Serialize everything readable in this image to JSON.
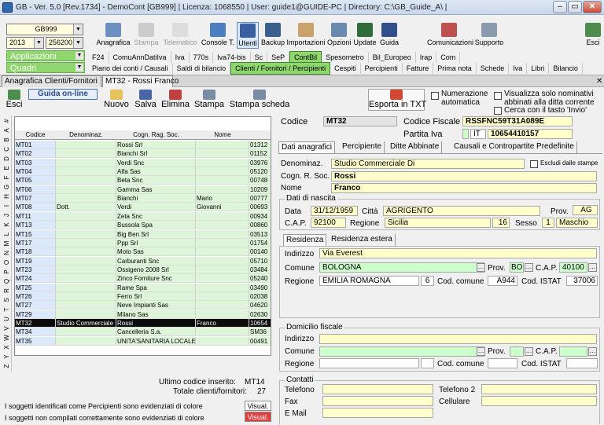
{
  "titlebar": {
    "text": "GB - Ver. 5.0 [Rev.1734] - DemoCont [GB999]   | Licenza: 1068550 | User: guide1@GUIDE-PC | Directory: C:\\GB_Guide_A\\ |"
  },
  "company": {
    "code": "GB999",
    "year": "2013",
    "period": "256200 -"
  },
  "toolbar": {
    "anagrafica": "Anagrafica",
    "stampa": "Stampa",
    "telematico": "Telematico",
    "console": "Console T.",
    "utenti": "Utenti",
    "backup": "Backup",
    "importazioni": "Importazioni",
    "opzioni": "Opzioni",
    "update": "Update",
    "guida": "Guida",
    "comunicazioni": "Comunicazioni",
    "supporto": "Supporto",
    "esci": "Esci"
  },
  "sections": {
    "applicazioni": "Applicazioni",
    "quadri": "Quadri"
  },
  "menu1": [
    "F24",
    "ComuAnnDatiIva",
    "Iva",
    "770s",
    "Iva74-bis",
    "Sc",
    "SeP",
    "ContBil",
    "Spesometro",
    "Bil_Europeo",
    "Irap",
    "Com"
  ],
  "menu2": [
    "Piano dei conti / Causali",
    "Saldi di bilancio",
    "Clienti / Fornitori / Percipienti",
    "Cespiti",
    "Percipienti",
    "Fatture",
    "Prima nota",
    "Schede",
    "Iva",
    "Libri",
    "Bilancio"
  ],
  "tabs": {
    "t1": "Anagrafica Clienti/Fornitori",
    "t2": "MT32 - Rossi Franco"
  },
  "actions": {
    "esci": "Esci",
    "guida": "Guida on-line",
    "nuovo": "Nuovo",
    "salva": "Salva",
    "elimina": "Elimina",
    "stampa": "Stampa",
    "stampa_scheda": "Stampa scheda",
    "esporta": "Esporta in TXT"
  },
  "options": {
    "numerazione": "Numerazione automatica",
    "visualizza": "Visualizza solo nominativi abbinati alla ditta corrente",
    "cerca": "Cerca con il tasto 'Invio'"
  },
  "alphabet": [
    "#",
    "A",
    "B",
    "C",
    "D",
    "E",
    "F",
    "G",
    "H",
    "I",
    "J",
    "K",
    "L",
    "M",
    "N",
    "O",
    "P",
    "Q",
    "R",
    "S",
    "T",
    "U",
    "V",
    "W",
    "X",
    "Y",
    "Z"
  ],
  "grid": {
    "headers": [
      "Codice",
      "Denominaz.",
      "Cogn. Rag. Soc.",
      "Nome",
      ""
    ],
    "rows": [
      [
        "MT01",
        "",
        "Rossi Srl",
        "",
        "01312"
      ],
      [
        "MT02",
        "",
        "Bianchi Srl",
        "",
        "01152"
      ],
      [
        "MT03",
        "",
        "Verdi Snc",
        "",
        "03976"
      ],
      [
        "MT04",
        "",
        "Alfa Sas",
        "",
        "05120"
      ],
      [
        "MT05",
        "",
        "Beta Snc",
        "",
        "00748"
      ],
      [
        "MT06",
        "",
        "Gamma Sas",
        "",
        "10209"
      ],
      [
        "MT07",
        "",
        "Bianchi",
        "Mario",
        "00777"
      ],
      [
        "MT08",
        "Dott.",
        "Verdi",
        "Giovanni",
        "00693"
      ],
      [
        "MT11",
        "",
        "Zeta Snc",
        "",
        "00934"
      ],
      [
        "MT13",
        "",
        "Bussola Spa",
        "",
        "00860"
      ],
      [
        "MT15",
        "",
        "Big Ben Srl",
        "",
        "03513"
      ],
      [
        "MT17",
        "",
        "Ppp Srl",
        "",
        "01754"
      ],
      [
        "MT18",
        "",
        "Moto Sas",
        "",
        "00140"
      ],
      [
        "MT19",
        "",
        "Carburanti Snc",
        "",
        "05710"
      ],
      [
        "MT23",
        "",
        "Ossigeno 2008 Srl",
        "",
        "03484"
      ],
      [
        "MT24",
        "",
        "Zinco Forniture Snc",
        "",
        "05240"
      ],
      [
        "MT25",
        "",
        "Rame Spa",
        "",
        "03490"
      ],
      [
        "MT26",
        "",
        "Ferro Srl",
        "",
        "02038"
      ],
      [
        "MT27",
        "",
        "Neve Impianti Sas",
        "",
        "04620"
      ],
      [
        "MT29",
        "",
        "Milano Sas",
        "",
        "02630"
      ],
      [
        "MT32",
        "Studio Commerciale",
        "Rossi",
        "Franco",
        "10654"
      ],
      [
        "MT34",
        "",
        "Cancelleria S.a.",
        "",
        "SM36"
      ],
      [
        "MT35",
        "",
        "UNITA'SANITARIA LOCALE",
        "",
        "00491"
      ]
    ],
    "selected_index": 20
  },
  "summary": {
    "ultimo_label": "Ultimo codice inserito:",
    "ultimo": "MT14",
    "totale_label": "Totale clienti/fornitori:",
    "totale": "27"
  },
  "legend": {
    "l1": "I soggetti identificati come Percipienti sono evidenziati di colore",
    "l2": "I soggetti non compilati correttamente sono evidenziati di colore",
    "visual": "Visual."
  },
  "form": {
    "codice_label": "Codice",
    "codice": "MT32",
    "cf_label": "Codice Fiscale",
    "cf": "RSSFNC59T31A089E",
    "piva_label": "Partita Iva",
    "piva_country": "IT",
    "piva": "10654410157",
    "info_tabs": [
      "Dati anagrafici",
      "Percipiente",
      "Ditte Abbinate",
      "Causali e Contropartite Predefinite"
    ],
    "denominaz_label": "Denominaz.",
    "denominaz": "Studio Commerciale Di",
    "escludi": "Escludi dalle stampe",
    "cognome_label": "Cogn. R. Soc.",
    "cognome": "Rossi",
    "nome_label": "Nome",
    "nome": "Franco",
    "nascita_title": "Dati di nascita",
    "data_label": "Data",
    "data": "31/12/1959",
    "citta_label": "Città",
    "citta": "AGRIGENTO",
    "prov_label": "Prov.",
    "prov": "AG",
    "cap_label": "C.A.P.",
    "cap": "92100",
    "regione_label": "Regione",
    "regione": "Sicilia",
    "regione_num": "16",
    "sesso_label": "Sesso",
    "sesso_num": "1",
    "sesso": "Maschio",
    "res_tabs": [
      "Residenza",
      "Residenza estera"
    ],
    "indirizzo_label": "Indirizzo",
    "indirizzo": "Via Everest",
    "comune_label": "Comune",
    "comune": "BOLOGNA",
    "prov2_label": "Prov.",
    "prov2": "BO",
    "cap2_label": "C.A.P.",
    "cap2": "40100",
    "regione2_label": "Regione",
    "regione2": "EMILIA ROMAGNA",
    "regione2_num": "6",
    "codcomune_label": "Cod. comune",
    "codcomune": "A944",
    "istat_label": "Cod. ISTAT",
    "istat": "37006",
    "domicilio_title": "Domicilio fiscale",
    "contatti_title": "Contatti",
    "telefono_label": "Telefono",
    "telefono2_label": "Telefono 2",
    "fax_label": "Fax",
    "cellulare_label": "Cellulare",
    "email_label": "E Mail"
  }
}
